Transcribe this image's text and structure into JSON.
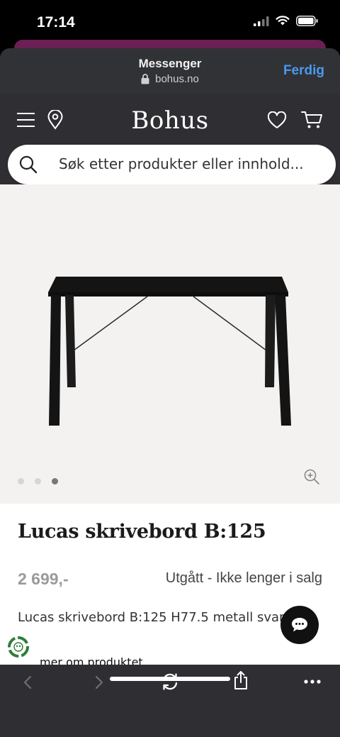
{
  "status_bar": {
    "time": "17:14"
  },
  "browser_header": {
    "title": "Messenger",
    "url": "bohus.no",
    "done_label": "Ferdig"
  },
  "site": {
    "logo": "Bohus",
    "search_placeholder": "Søk etter produkter eller innhold..."
  },
  "gallery": {
    "image_count": 3,
    "active_index": 2
  },
  "product": {
    "title": "Lucas skrivebord B:125",
    "price": "2 699,-",
    "stock_status": "Utgått - Ikke lenger i salg",
    "description": "Lucas skrivebord B:125 H77.5 metall svart",
    "more_link": "mer om produktet"
  },
  "colors": {
    "accent": "#4a9af0",
    "header_bg": "#2f2f33",
    "gallery_bg": "#f3f2f0"
  }
}
